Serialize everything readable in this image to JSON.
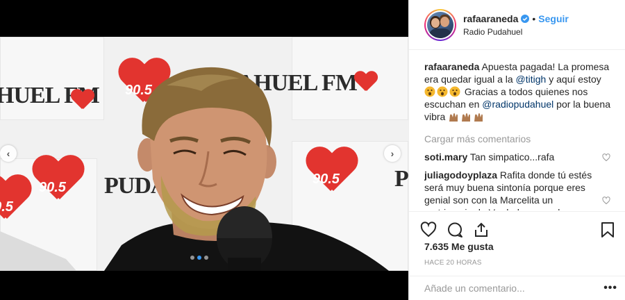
{
  "post": {
    "username": "rafaaraneda",
    "separator": "•",
    "follow_label": "Seguir",
    "location": "Radio Pudahuel",
    "caption": {
      "username": "rafaaraneda",
      "text_1": "Apuesta pagada! La promesa era quedar igual a la",
      "mention_1": "@titigh",
      "text_2": "y aquí estoy",
      "text_3": "Gracias a todos quienes nos escuchan en",
      "mention_2": "@radiopudahuel",
      "text_4": "por la buena vibra"
    },
    "load_more_label": "Cargar más comentarios",
    "comments": [
      {
        "username": "soti.mary",
        "text": "Tan simpatico...rafa"
      },
      {
        "username": "juliagodoyplaza",
        "text": "Rafita donde tú estés será muy buena sintonía porque eres genial son con la Marcelita un matrimonio de Verdad no para la"
      }
    ],
    "likes": "7.635 Me gusta",
    "timestamp": "HACE 20 HORAS",
    "add_comment_placeholder": "Añade un comentario...",
    "more_options": "•••"
  },
  "media": {
    "backdrop_brand_1": "DAHUEL FM",
    "backdrop_brand_2": "HUEL FM",
    "backdrop_brand_3": "PUDA",
    "backdrop_brand_4": "PU",
    "logo_number": "90.5",
    "prev_arrow": "‹",
    "next_arrow": "›",
    "slide_count": 3,
    "active_slide": 2
  },
  "colors": {
    "link": "#3897f0",
    "mention": "#003569",
    "muted": "#999999",
    "brand_red": "#e2342f",
    "border": "#efefef"
  },
  "icons": [
    "verified-icon",
    "heart-icon",
    "comment-icon",
    "share-icon",
    "bookmark-icon",
    "prev-arrow-icon",
    "next-arrow-icon",
    "surprised-emoji-icon",
    "hands-emoji-icon"
  ]
}
